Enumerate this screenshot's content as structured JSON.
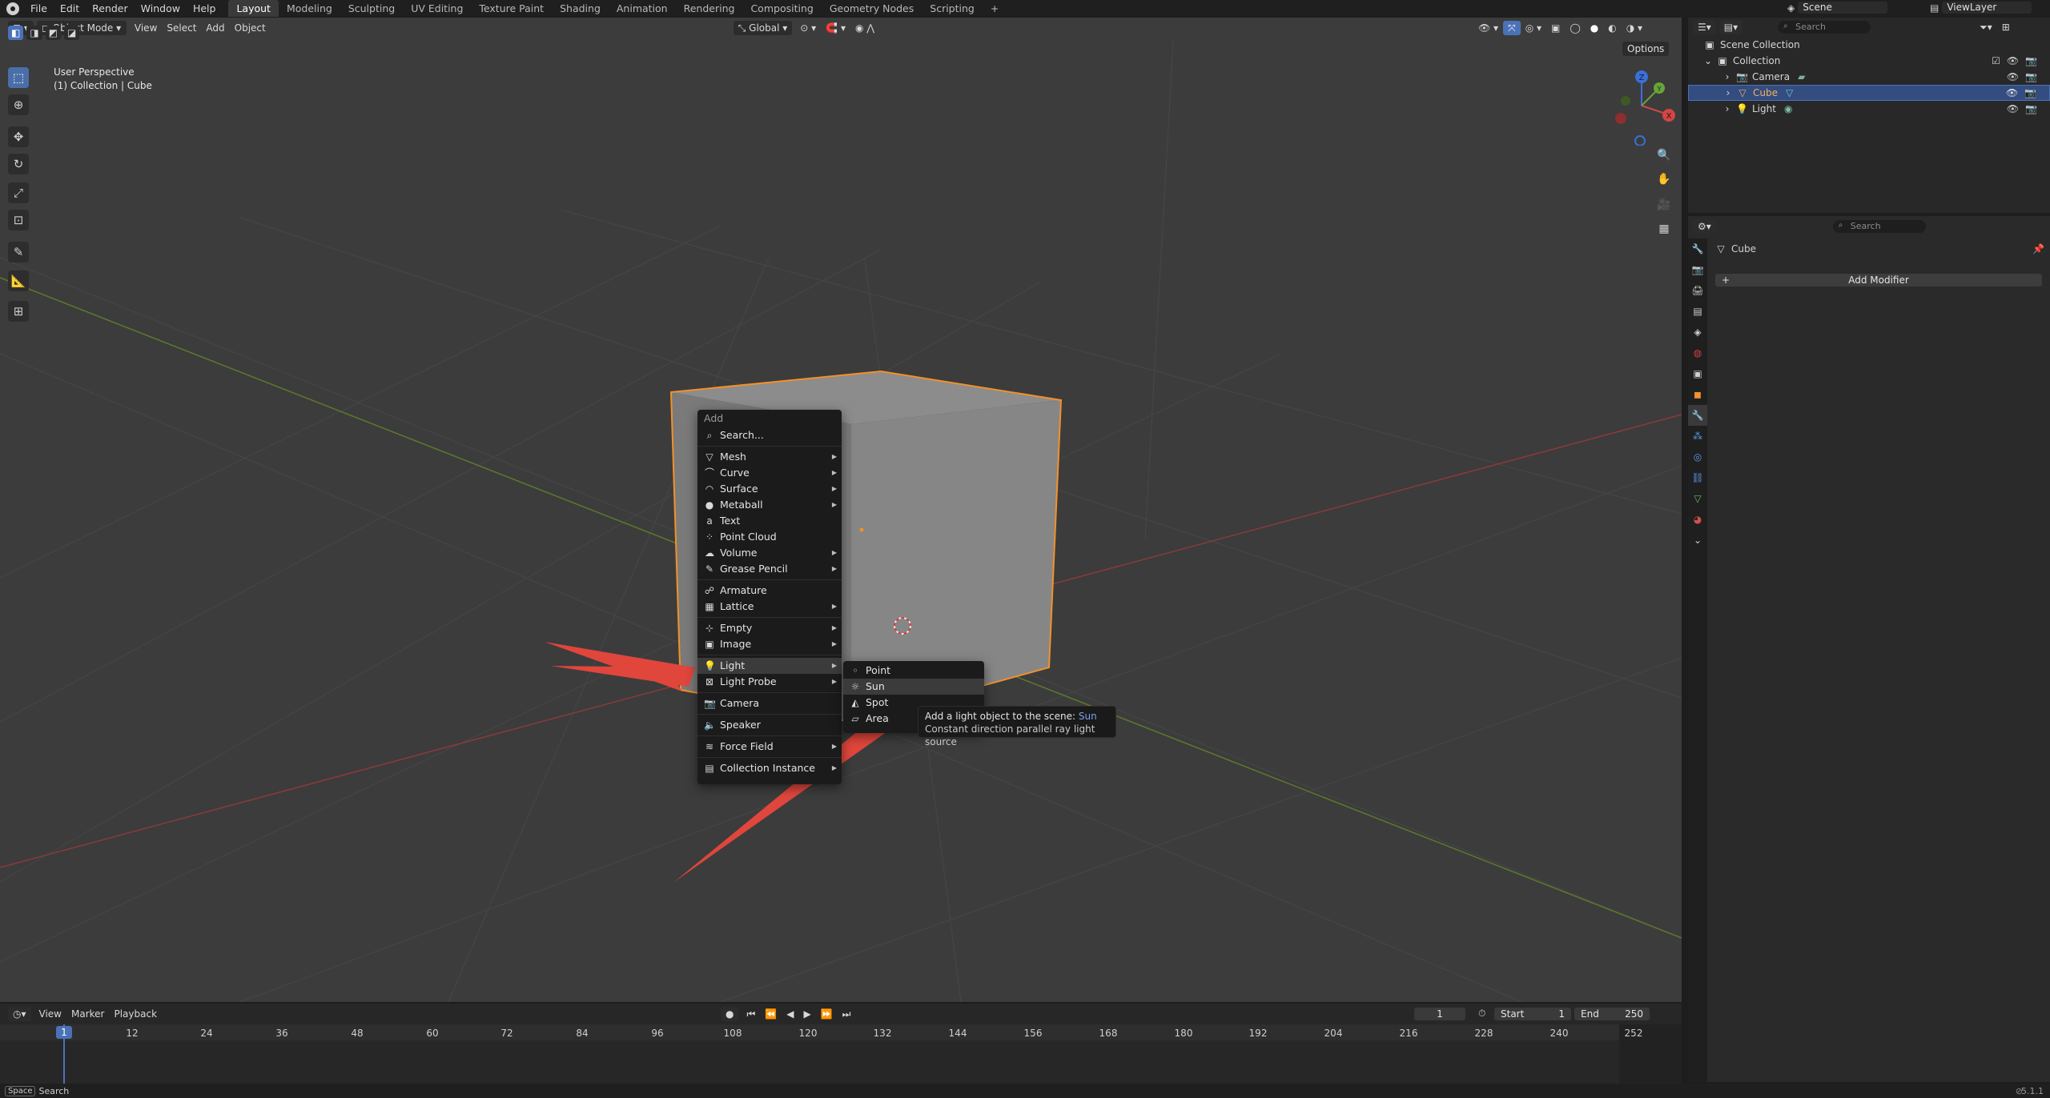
{
  "topbar": {
    "menus": [
      "File",
      "Edit",
      "Render",
      "Window",
      "Help"
    ],
    "workspaces": [
      "Layout",
      "Modeling",
      "Sculpting",
      "UV Editing",
      "Texture Paint",
      "Shading",
      "Animation",
      "Rendering",
      "Compositing",
      "Geometry Nodes",
      "Scripting"
    ],
    "add_tab": "+",
    "scene": "Scene",
    "view_layer": "ViewLayer"
  },
  "viewport": {
    "mode": "Object Mode",
    "menus": [
      "View",
      "Select",
      "Add",
      "Object"
    ],
    "transform_orientation": "Global",
    "options": "Options",
    "perspective": "User Perspective",
    "context": "(1) Collection | Cube",
    "gizmo_z": "Z",
    "gizmo_y": "Y",
    "gizmo_x": "X"
  },
  "add_menu": {
    "title": "Add",
    "search": "Search...",
    "items": [
      {
        "label": "Mesh",
        "icon": "mesh-icon",
        "sub": true
      },
      {
        "label": "Curve",
        "icon": "curve-icon",
        "sub": true
      },
      {
        "label": "Surface",
        "icon": "surface-icon",
        "sub": true
      },
      {
        "label": "Metaball",
        "icon": "metaball-icon",
        "sub": true
      },
      {
        "label": "Text",
        "icon": "text-icon",
        "sub": false
      },
      {
        "label": "Point Cloud",
        "icon": "point-cloud-icon",
        "sub": false
      },
      {
        "label": "Volume",
        "icon": "volume-icon",
        "sub": true
      },
      {
        "label": "Grease Pencil",
        "icon": "grease-pencil-icon",
        "sub": true
      },
      {
        "label": "Armature",
        "icon": "armature-icon",
        "sub": false
      },
      {
        "label": "Lattice",
        "icon": "lattice-icon",
        "sub": true
      },
      {
        "label": "Empty",
        "icon": "empty-icon",
        "sub": true
      },
      {
        "label": "Image",
        "icon": "image-icon",
        "sub": true
      },
      {
        "label": "Light",
        "icon": "light-icon",
        "sub": true
      },
      {
        "label": "Light Probe",
        "icon": "light-probe-icon",
        "sub": true
      },
      {
        "label": "Camera",
        "icon": "camera-icon",
        "sub": false
      },
      {
        "label": "Speaker",
        "icon": "speaker-icon",
        "sub": false
      },
      {
        "label": "Force Field",
        "icon": "force-field-icon",
        "sub": true
      },
      {
        "label": "Collection Instance",
        "icon": "collection-instance-icon",
        "sub": true
      }
    ],
    "highlighted": "Light"
  },
  "light_submenu": {
    "items": [
      "Point",
      "Sun",
      "Spot",
      "Area"
    ],
    "highlighted": "Sun"
  },
  "tooltip": {
    "line1_prefix": "Add a light object to the scene: ",
    "line1_value": "Sun",
    "line2": "Constant direction parallel ray light source"
  },
  "outliner": {
    "search_placeholder": "Search",
    "root": "Scene Collection",
    "collection": "Collection",
    "objects": [
      "Camera",
      "Cube",
      "Light"
    ],
    "selected": "Cube"
  },
  "properties": {
    "search_placeholder": "Search",
    "object_name": "Cube",
    "add_modifier": "Add Modifier"
  },
  "timeline": {
    "menus": [
      "View",
      "Marker",
      "Playback"
    ],
    "current_frame": "1",
    "start_label": "Start",
    "start": "1",
    "end_label": "End",
    "end": "250",
    "ticks": [
      "1",
      "12",
      "24",
      "36",
      "48",
      "60",
      "72",
      "84",
      "96",
      "108",
      "120",
      "132",
      "144",
      "156",
      "168",
      "180",
      "192",
      "204",
      "216",
      "228",
      "240",
      "252"
    ]
  },
  "statusbar": {
    "key": "Space",
    "action": "Search",
    "version": "5.1.1"
  },
  "colors": {
    "accent": "#4b72b8",
    "selection_outline": "#f2912a",
    "annotation_arrow": "#e0463c"
  }
}
